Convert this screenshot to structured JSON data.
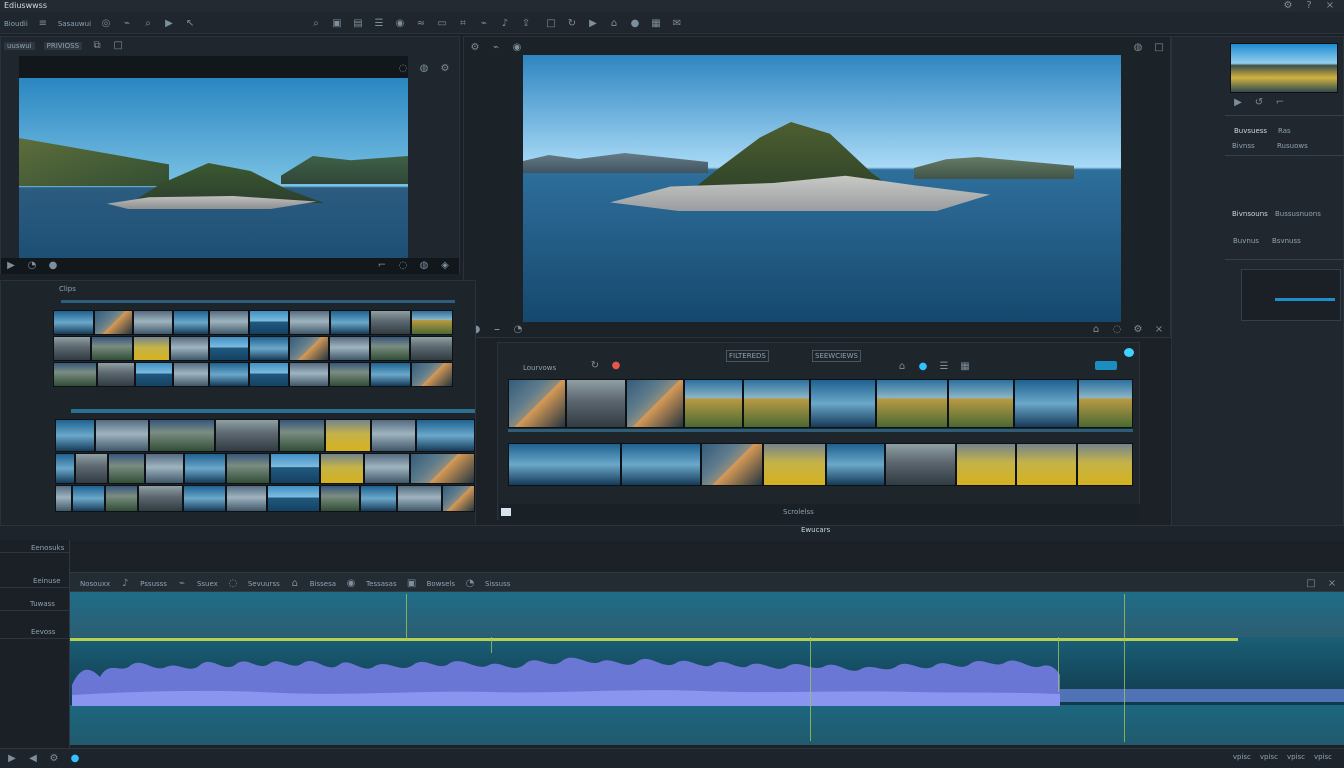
{
  "app": {
    "title": "Ediuswwss"
  },
  "topbar": {
    "menu_left": [
      "Bioudii",
      "Sasauwui"
    ],
    "right_icons": [
      "settings-icon",
      "help-icon",
      "close-icon"
    ]
  },
  "source_panel": {
    "tabs": [
      "uuswui",
      "PRIVIOSS"
    ],
    "footer_icons": [
      "play-icon",
      "volume-icon",
      "record-icon"
    ]
  },
  "program_panel": {
    "footer_icons": [
      "record-icon",
      "mark-in-icon",
      "mark-out-icon",
      "settings-icon"
    ]
  },
  "inspector": {
    "sections": [
      {
        "title": "Buvsuess",
        "value": "Ras"
      },
      {
        "title": "Bivnss",
        "value": "Rusuows"
      },
      {
        "title": "Bivnsouns",
        "value": "Bussusnuons"
      },
      {
        "title": "Buvnus",
        "value": "Bsvnuss"
      }
    ]
  },
  "browser_left": {
    "label": "Clips"
  },
  "browser_right": {
    "title": "Lourvows",
    "controls": [
      "FILTEREDS",
      "SEEWCIEWS"
    ],
    "status": "Scrolelss"
  },
  "timeline": {
    "caption": "Ewucars",
    "left_labels": [
      "Eenosuks",
      "Eeinuse",
      "Tuwass",
      "Eevoss"
    ],
    "track_labels": [
      "Nosouxx",
      "Pssusss",
      "Ssuex",
      "Sevuurss",
      "Bissesa",
      "Tessasas",
      "Bowsels",
      "Sissuss"
    ],
    "footer_right": [
      "vpisc",
      "vpisc",
      "vpisc",
      "vpisc"
    ]
  },
  "colors": {
    "accent": "#1a9ad3",
    "wave": "#6d78db",
    "marker": "#b7cf4c",
    "panel": "#1f262d"
  }
}
